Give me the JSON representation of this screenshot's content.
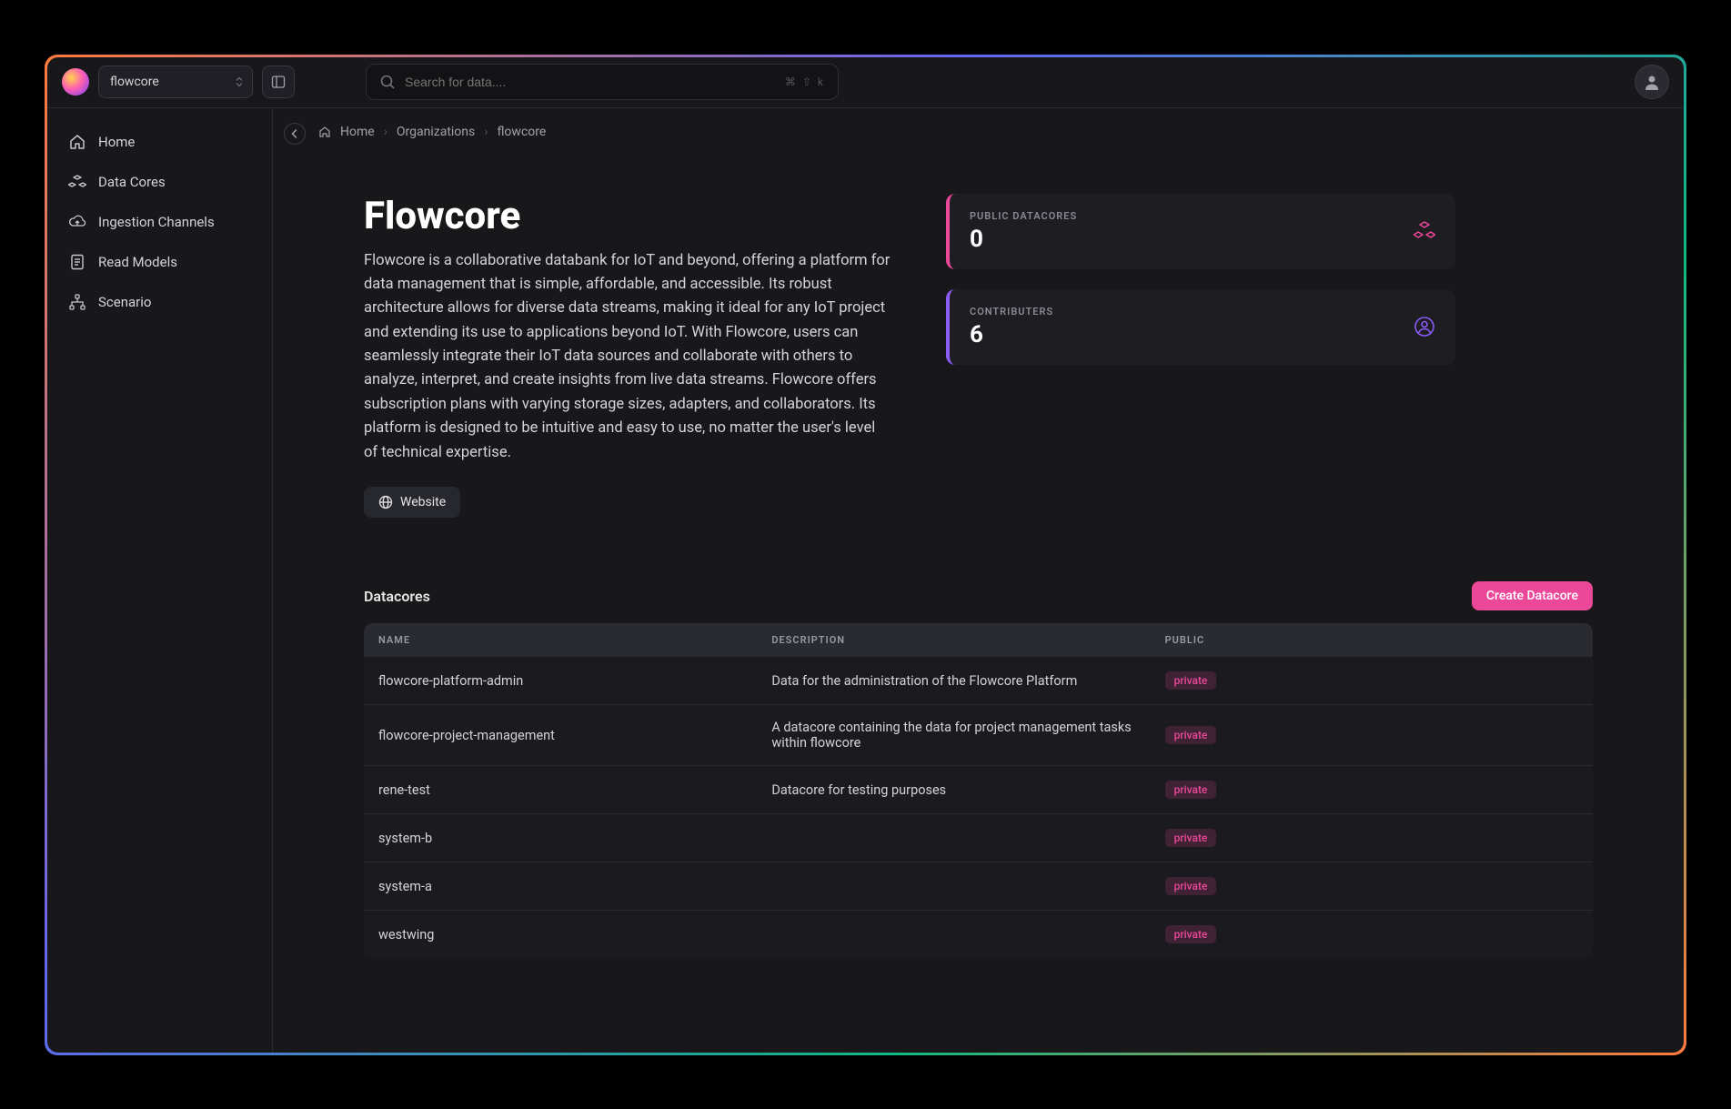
{
  "topbar": {
    "org_selected": "flowcore",
    "search_placeholder": "Search for data....",
    "kbd_hint": "⌘ ⇧ k"
  },
  "sidebar": {
    "items": [
      {
        "label": "Home"
      },
      {
        "label": "Data Cores"
      },
      {
        "label": "Ingestion Channels"
      },
      {
        "label": "Read Models"
      },
      {
        "label": "Scenario"
      }
    ]
  },
  "breadcrumb": {
    "home": "Home",
    "org": "Organizations",
    "current": "flowcore"
  },
  "hero": {
    "title": "Flowcore",
    "description": "Flowcore is a collaborative databank for IoT and beyond, offering a platform for data management that is simple, affordable, and accessible. Its robust architecture allows for diverse data streams, making it ideal for any IoT project and extending its use to applications beyond IoT. With Flowcore, users can seamlessly integrate their IoT data sources and collaborate with others to analyze, interpret, and create insights from live data streams. Flowcore offers subscription plans with varying storage sizes, adapters, and collaborators. Its platform is designed to be intuitive and easy to use, no matter the user's level of technical expertise.",
    "website_label": "Website"
  },
  "stats": {
    "datacores_label": "PUBLIC DATACORES",
    "datacores_value": "0",
    "contributers_label": "CONTRIBUTERS",
    "contributers_value": "6"
  },
  "datacores": {
    "section_title": "Datacores",
    "create_label": "Create Datacore",
    "columns": {
      "name": "Name",
      "description": "Description",
      "public": "Public"
    },
    "rows": [
      {
        "name": "flowcore-platform-admin",
        "description": "Data for the administration of the Flowcore Platform",
        "badge": "private"
      },
      {
        "name": "flowcore-project-management",
        "description": "A datacore containing the data for project management tasks within flowcore",
        "badge": "private"
      },
      {
        "name": "rene-test",
        "description": "Datacore for testing purposes",
        "badge": "private"
      },
      {
        "name": "system-b",
        "description": "",
        "badge": "private"
      },
      {
        "name": "system-a",
        "description": "",
        "badge": "private"
      },
      {
        "name": "westwing",
        "description": "",
        "badge": "private"
      }
    ]
  }
}
